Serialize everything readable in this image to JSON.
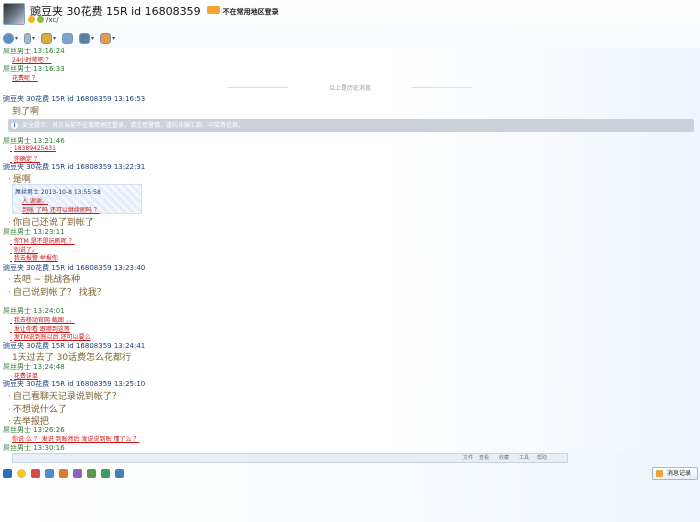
{
  "window": {
    "title": "豌豆夹  30花费  15R   id  16808359",
    "warning": "不在常用地区登录",
    "subtitle": "/xc/"
  },
  "toolbar": {
    "icons": [
      "camera-icon",
      "mic-icon",
      "folder-icon",
      "screen-share-icon",
      "app-icon",
      "apps-grid-icon"
    ]
  },
  "chat": {
    "divider": "以上是历史消息",
    "notice": "安全提示：对方当前不在常用地区登录，请注意警惕，谨防诈骗汇款、中奖等信息。",
    "messages": [
      {
        "head": "屌丝男士   13:16:24",
        "lines": [
          "24小时帅吧 ？"
        ],
        "head_style": "gray",
        "line_style": "red"
      },
      {
        "head": "屌丝男士   13:16:33",
        "lines": [
          "花费呢 ？"
        ],
        "head_style": "gray",
        "line_style": "red"
      },
      {
        "head": "豌豆夹  30花费  15R   id  16808359   13:16:53",
        "lines": [
          "到了啊"
        ],
        "head_style": "blue",
        "line_style": "big"
      },
      {
        "head": "屌丝男士   13:21:46",
        "lines": [
          "18389425431",
          "你确定 ？"
        ],
        "head_style": "gray",
        "line_style": "red"
      },
      {
        "head": "豌豆夹  30花费  15R   id  16808359   13:22:31",
        "lines": [
          "是啊"
        ],
        "head_style": "blue",
        "line_style": "big"
      },
      {
        "head": "屌丝男士 2013-10-8 13:55:58",
        "lines": [
          "人 谢谢。",
          "到账 了吗 还可以继续刷吗 ？"
        ],
        "head_style": "quote",
        "line_style": "red"
      },
      {
        "head": "",
        "lines": [
          "你自己还说了到帐了"
        ],
        "head_style": "none",
        "line_style": "big"
      },
      {
        "head": "屌丝男士   13:23:11",
        "lines": [
          "你TM 是不是玩刷呢 ？",
          "别说了。",
          "我去报警 举报你"
        ],
        "head_style": "gray",
        "line_style": "red"
      },
      {
        "head": "豌豆夹  30花费  15R   id  16808359   13:23:40",
        "lines": [
          "去吧 ~   挑战各种",
          "自己说到帐了？ 找我？"
        ],
        "head_style": "blue",
        "line_style": "big"
      },
      {
        "head": "屌丝男士   13:24:01",
        "lines": [
          "我去移动官网 截图 ，，",
          "发让你看 跟哪到这等",
          "发TM说到账以后   还可以要么"
        ],
        "head_style": "gray",
        "line_style": "red"
      },
      {
        "head": "豌豆夹  30花费  15R   id  16808359   13:24:41",
        "lines": [
          "1天过去了  30话费怎么花都行"
        ],
        "head_style": "blue",
        "line_style": "big"
      },
      {
        "head": "屌丝男士   13:24:48",
        "lines": [
          "花费详单"
        ],
        "head_style": "gray",
        "line_style": "red"
      },
      {
        "head": "豌豆夹  30花费  15R   id  16808359   13:25:10",
        "lines": [
          "自己看聊天记录说到帐了？",
          "不想说什么了",
          "去举报把"
        ],
        "head_style": "blue",
        "line_style": "big"
      },
      {
        "head": "屌丝男士   13:26:26",
        "lines": [
          "你说 么 ？ 发说  到账然后  发说说到账   懂了么 ？"
        ],
        "head_style": "gray",
        "line_style": "red"
      },
      {
        "head": "屌丝男士   13:30:16",
        "lines": [],
        "head_style": "gray",
        "line_style": "red"
      }
    ]
  },
  "input": {
    "mini_labels": [
      "文件",
      "查看",
      "收藏",
      "工具",
      "帮助"
    ],
    "history_label": "消息记录"
  },
  "colors": {
    "gray_head": "#2f7a34",
    "blue_head": "#1b3f7a",
    "red_text": "#c81414",
    "notice_bg": "#c9d2db"
  }
}
